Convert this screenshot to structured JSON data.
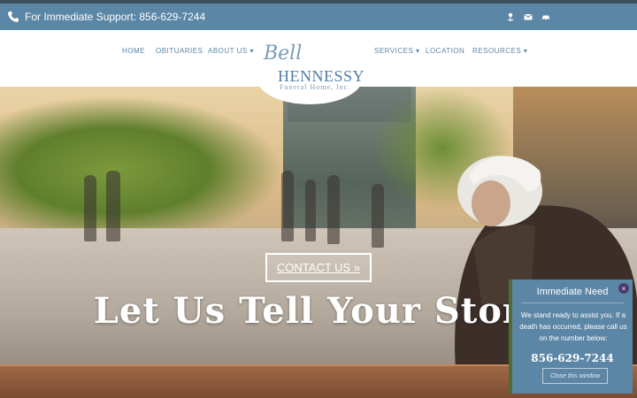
{
  "topbar": {
    "support_text": "For Immediate Support: 856-629-7244",
    "icons": [
      "phone-icon",
      "flower-icon",
      "envelope-icon",
      "car-icon"
    ]
  },
  "nav": {
    "items": [
      {
        "label": "HOME"
      },
      {
        "label": "OBITUARIES"
      },
      {
        "label": "ABOUT US ▾"
      },
      {
        "label": "SERVICES ▾"
      },
      {
        "label": "LOCATION"
      },
      {
        "label": "RESOURCES ▾"
      }
    ]
  },
  "logo": {
    "script": "Bell",
    "name": "HENNESSY",
    "subtitle": "Funeral Home, Inc."
  },
  "hero": {
    "headline": "Let Us Tell Your Story",
    "cta_label": "CONTACT US »"
  },
  "popup": {
    "title": "Immediate Need",
    "body": "We stand ready to assist you. If a death has occurred, please call us on the number below:",
    "phone": "856-629-7244",
    "close_label": "Close this window",
    "close_icon_glyph": "×"
  },
  "colors": {
    "primary": "#5b86a6",
    "popup_accent": "#4f6b38",
    "close_badge": "#4b3a6b"
  }
}
